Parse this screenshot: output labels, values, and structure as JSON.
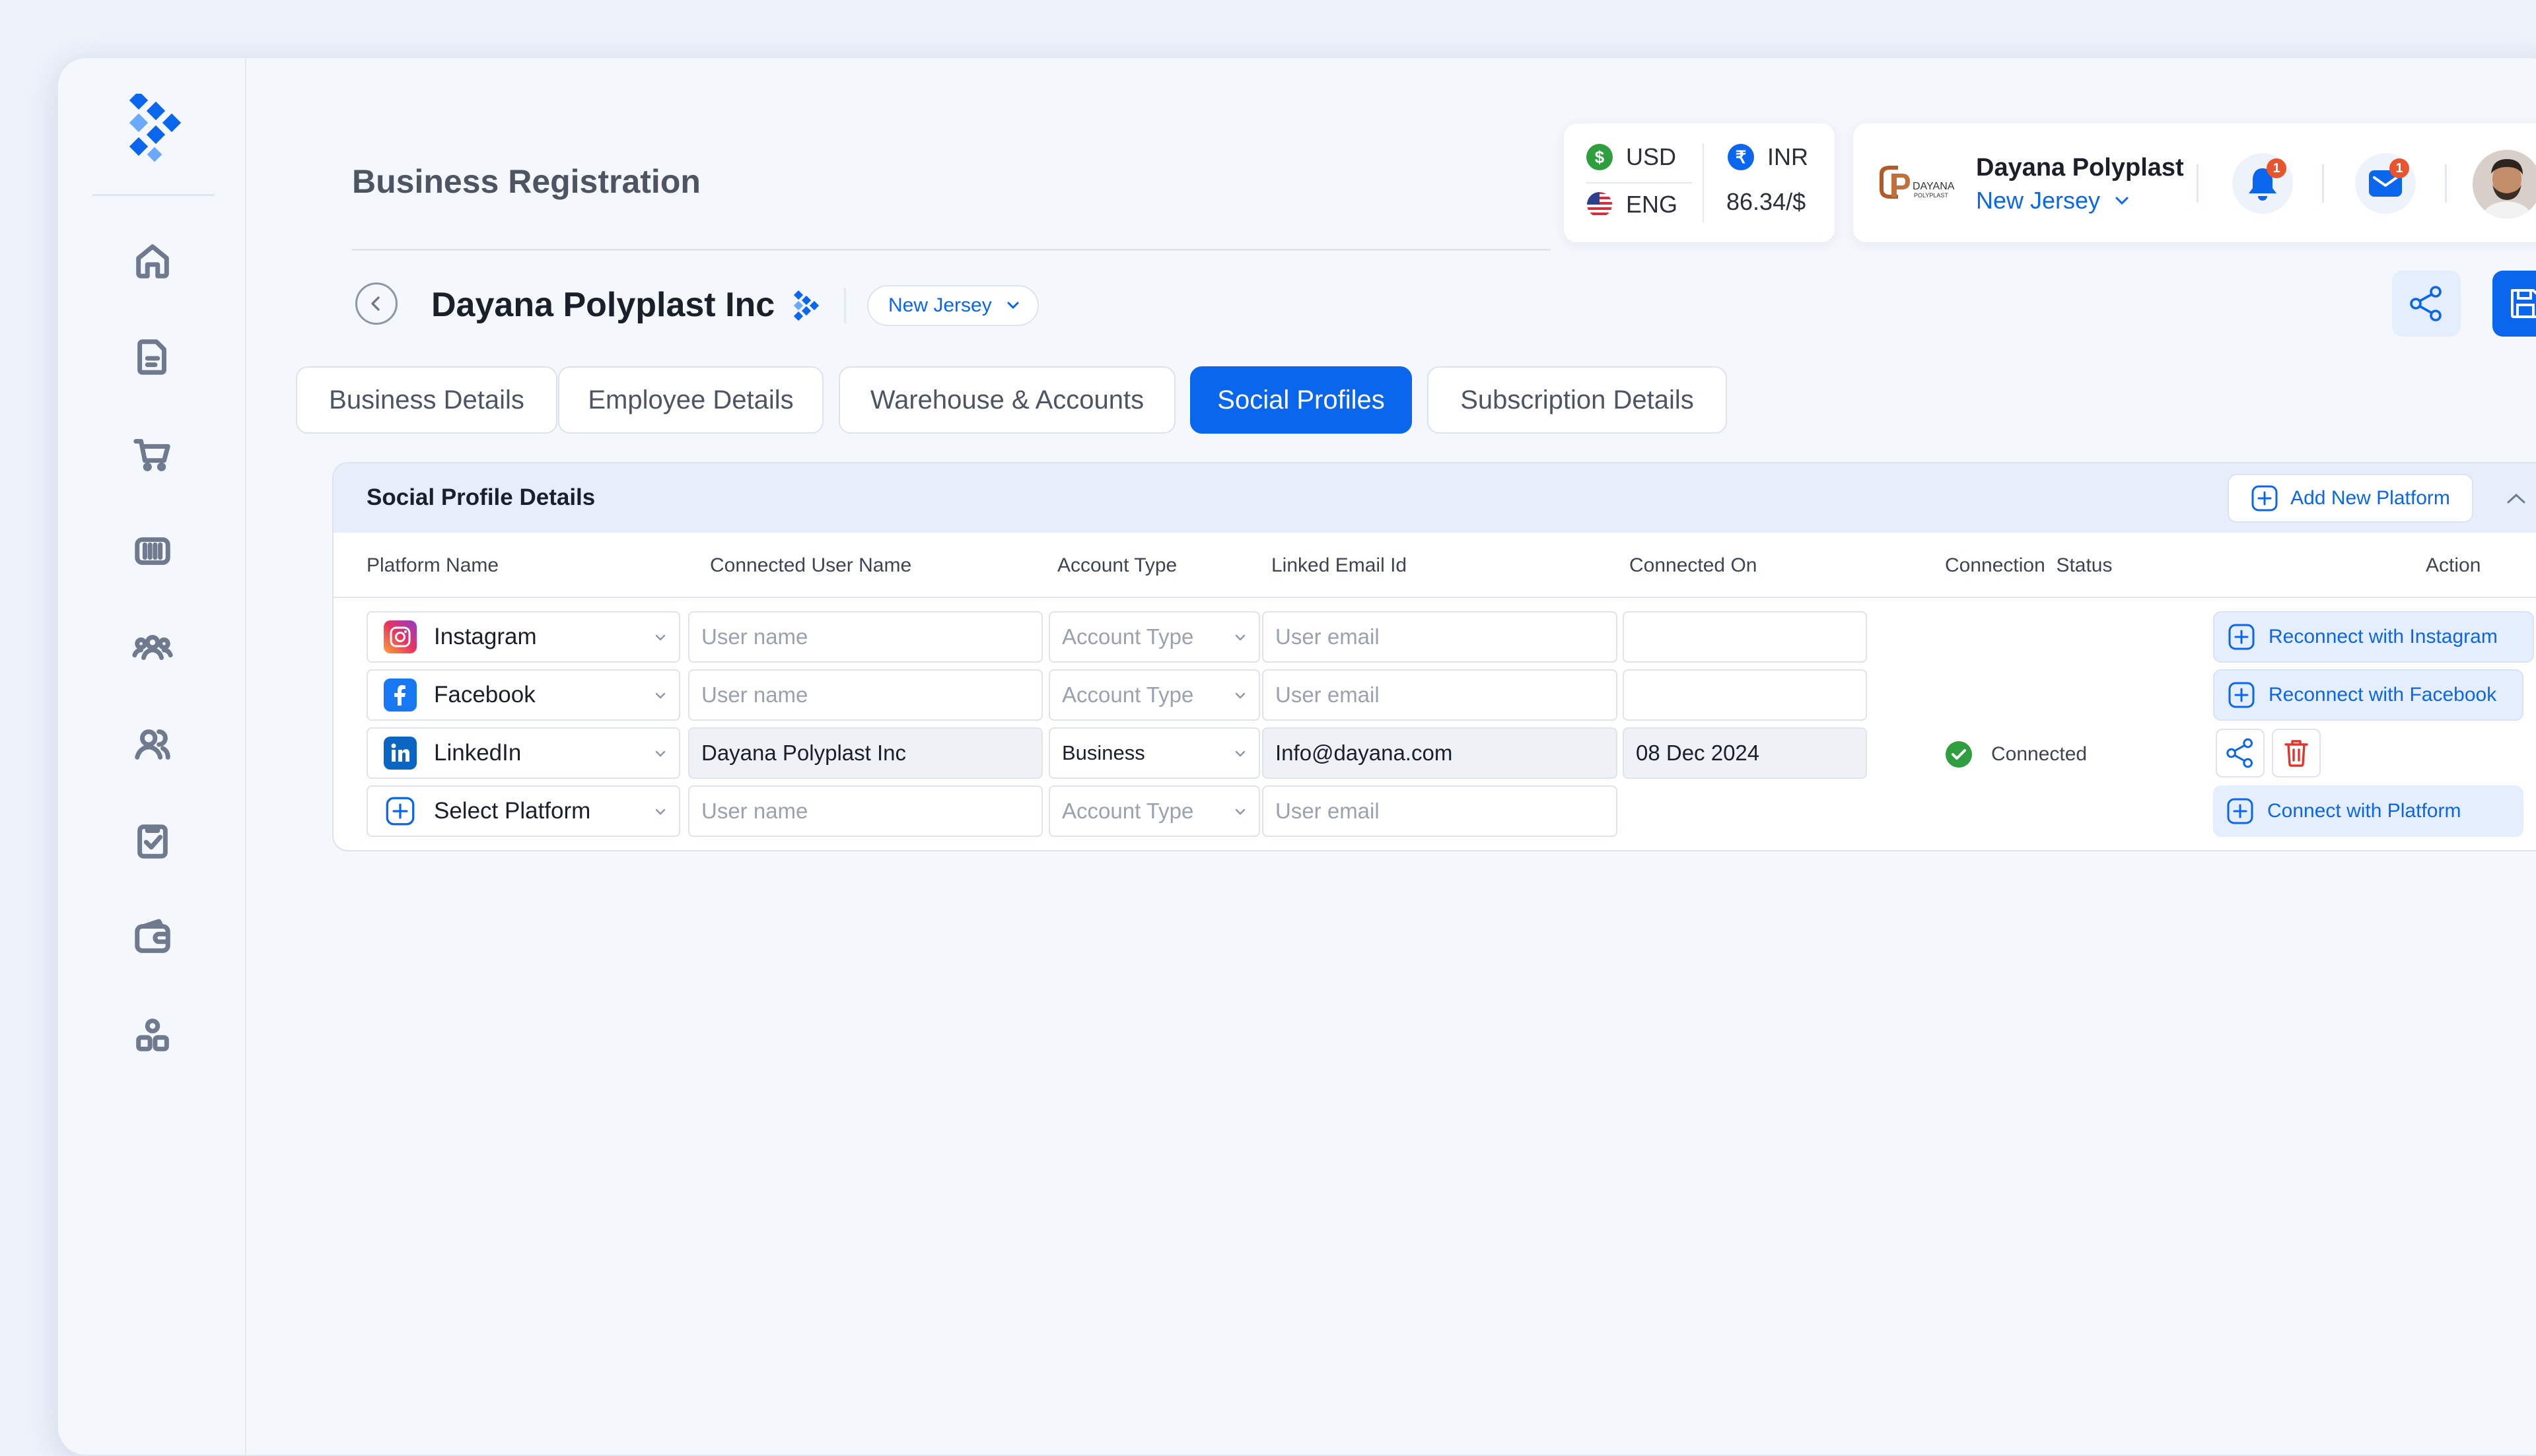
{
  "header": {
    "page_title": "Business Registration",
    "currency": {
      "base_code": "USD",
      "base_symbol": "$",
      "language": "ENG",
      "target_code": "INR",
      "target_symbol": "₹",
      "rate": "86.34/$"
    },
    "company": {
      "logo_text_top": "DAYANA",
      "logo_text_bottom": "POLYPLAST",
      "name": "Dayana Polyplast",
      "location": "New Jersey"
    },
    "notifications_count": "1",
    "messages_count": "1"
  },
  "business": {
    "name": "Dayana Polyplast Inc",
    "location": "New Jersey"
  },
  "tabs": [
    {
      "label": "Business Details",
      "active": false
    },
    {
      "label": "Employee Details",
      "active": false
    },
    {
      "label": "Warehouse & Accounts",
      "active": false
    },
    {
      "label": "Social Profiles",
      "active": true
    },
    {
      "label": "Subscription Details",
      "active": false
    }
  ],
  "panel": {
    "title": "Social Profile Details",
    "add_button": "Add New Platform",
    "columns": [
      "Platform Name",
      "Connected User Name",
      "Account Type",
      "Linked Email Id",
      "Connected On",
      "Connection  Status",
      "Action"
    ],
    "rows": [
      {
        "platform": "Instagram",
        "platform_icon": "instagram-icon",
        "user_name": "",
        "user_name_placeholder": "User name",
        "account_type": "Account Type",
        "email": "",
        "email_placeholder": "User email",
        "connected_on": "",
        "status": "",
        "action": "Reconnect with Instagram"
      },
      {
        "platform": "Facebook",
        "platform_icon": "facebook-icon",
        "user_name": "",
        "user_name_placeholder": "User name",
        "account_type": "Account Type",
        "email": "",
        "email_placeholder": "User email",
        "connected_on": "",
        "status": "",
        "action": "Reconnect with Facebook"
      },
      {
        "platform": "LinkedIn",
        "platform_icon": "linkedin-icon",
        "user_name": "Dayana Polyplast Inc",
        "account_type": "Business",
        "email": "Info@dayana.com",
        "connected_on": "08 Dec 2024",
        "status": "Connected"
      },
      {
        "platform": "Select Platform",
        "platform_icon": "plus-icon",
        "user_name": "",
        "user_name_placeholder": "User name",
        "account_type": "Account Type",
        "email": "",
        "email_placeholder": "User email",
        "action": "Connect with Platform"
      }
    ]
  },
  "colors": {
    "primary": "#0a66ec",
    "success": "#2e9e3f",
    "danger": "#e0352b",
    "badge": "#e8542c"
  }
}
